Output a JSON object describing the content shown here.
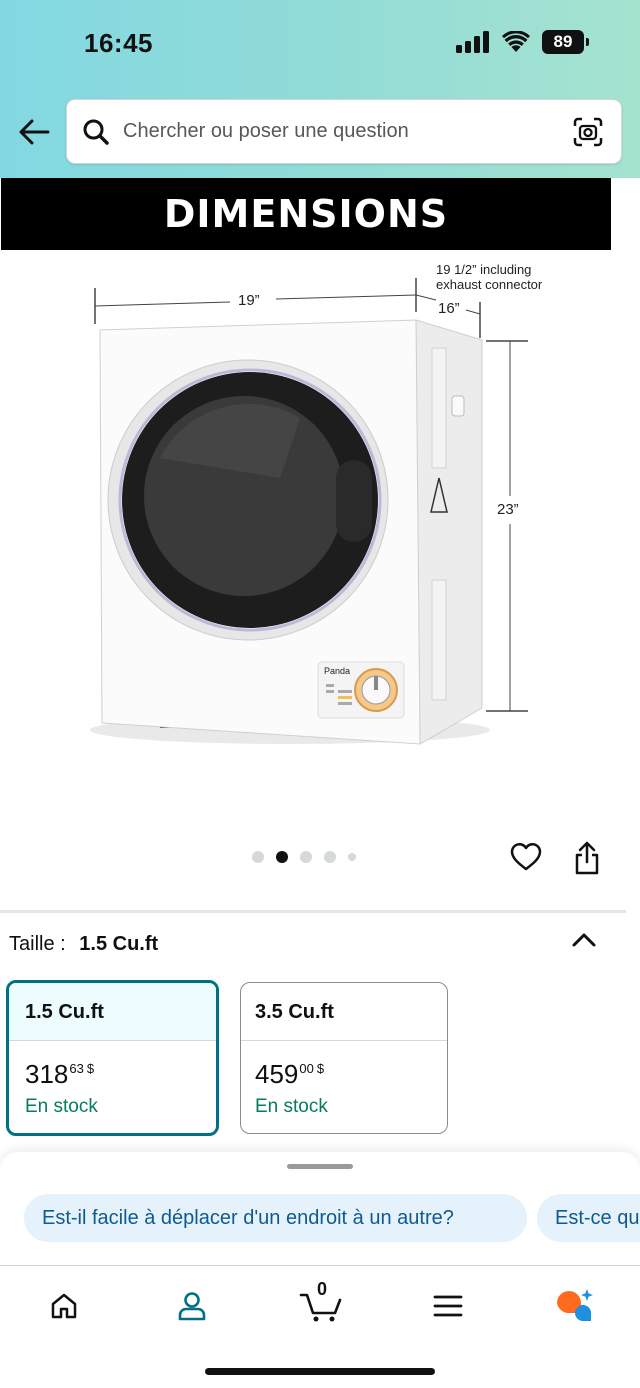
{
  "status_bar": {
    "time": "16:45",
    "battery": "89"
  },
  "search": {
    "placeholder": "Chercher ou poser une question"
  },
  "product_image": {
    "banner": "DIMENSIONS",
    "dim_width": "19”",
    "dim_depth": "16”",
    "dim_height": "23”",
    "dim_note_line1": "19 1/2” including",
    "dim_note_line2": "exhaust connector",
    "brand": "Panda"
  },
  "carousel": {
    "total": 5,
    "active": 2
  },
  "size_selector": {
    "label": "Taille :",
    "selected_value": "1.5 Cu.ft",
    "options": [
      {
        "name": "1.5 Cu.ft",
        "price_whole": "318",
        "price_cents": "63",
        "currency": "$",
        "stock": "En stock",
        "selected": true
      },
      {
        "name": "3.5 Cu.ft",
        "price_whole": "459",
        "price_cents": "00",
        "currency": "$",
        "stock": "En stock",
        "selected": false
      }
    ]
  },
  "questions": [
    "Est-il facile à déplacer d'un endroit à un autre?",
    "Est-ce qu"
  ],
  "bottom_nav": {
    "cart_count": "0"
  },
  "colors": {
    "accent": "#007185",
    "stock_green": "#067d62",
    "chip_bg": "#e6f2fb",
    "chip_text": "#0f5a8f",
    "header_start": "#82d8e2",
    "header_end": "#a5e3cf"
  }
}
